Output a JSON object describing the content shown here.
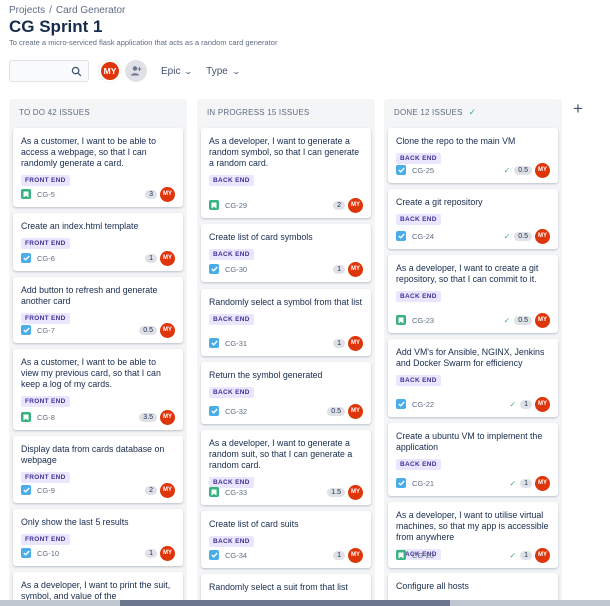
{
  "breadcrumb": {
    "projects": "Projects",
    "separator": "/",
    "project": "Card Generator"
  },
  "page": {
    "title": "CG Sprint 1",
    "subtitle": "To create a micro-serviced flask application that acts as a random card generator"
  },
  "toolbar": {
    "search_placeholder": "",
    "avatar_initials": "MY",
    "epic_label": "Epic",
    "type_label": "Type",
    "add_people_icon": "add-person-icon",
    "search_icon": "search-icon",
    "chevron_icon": "chevron-down-icon"
  },
  "colors": {
    "avatar": "#de350b",
    "label_bg": "#eae6ff",
    "label_fg": "#403294",
    "story": "#36b37e",
    "task": "#4bade8"
  },
  "columns": [
    {
      "header": "TO DO 42 ISSUES",
      "cards": [
        {
          "title": "As a customer, I want to be able to access a webpage, so that I can randomly generate a card.",
          "label": "FRONT END",
          "type": "story",
          "key": "CG-5",
          "estimate": "3",
          "assignee": "MY"
        },
        {
          "title": "Create an index.html template",
          "label": "FRONT END",
          "type": "task",
          "key": "CG-6",
          "estimate": "1",
          "assignee": "MY"
        },
        {
          "title": "Add button to refresh and generate another card",
          "label": "FRONT END",
          "type": "task",
          "key": "CG-7",
          "estimate": "0.5",
          "assignee": "MY"
        },
        {
          "title": "As a customer, I want to be able to view my previous card, so that I can keep a log of my cards.",
          "label": "FRONT END",
          "type": "story",
          "key": "CG-8",
          "estimate": "3.5",
          "assignee": "MY"
        },
        {
          "title": "Display data from cards database on webpage",
          "label": "FRONT END",
          "type": "task",
          "key": "CG-9",
          "estimate": "2",
          "assignee": "MY"
        },
        {
          "title": "Only show the last 5 results",
          "label": "FRONT END",
          "type": "task",
          "key": "CG-10",
          "estimate": "1",
          "assignee": "MY"
        },
        {
          "title": "As a developer, I want to print the suit, symbol, and value of the",
          "label": "",
          "type": "",
          "key": "",
          "estimate": "",
          "assignee": ""
        }
      ]
    },
    {
      "header": "IN PROGRESS 15 ISSUES",
      "cards": [
        {
          "title": "As a developer, I want to generate a random symbol, so that I can generate a random card.",
          "label": "BACK END",
          "type": "story",
          "key": "CG-29",
          "estimate": "2",
          "assignee": "MY"
        },
        {
          "title": "Create list of card symbols",
          "label": "BACK END",
          "type": "task",
          "key": "CG-30",
          "estimate": "1",
          "assignee": "MY"
        },
        {
          "title": "Randomly select a symbol from that list",
          "label": "BACK END",
          "type": "task",
          "key": "CG-31",
          "estimate": "1",
          "assignee": "MY"
        },
        {
          "title": "Return the symbol generated",
          "label": "BACK END",
          "type": "task",
          "key": "CG-32",
          "estimate": "0.5",
          "assignee": "MY"
        },
        {
          "title": "As a developer, I want to generate a random suit, so that I can generate a random card.",
          "label": "BACK END",
          "type": "story",
          "key": "CG-33",
          "estimate": "1.5",
          "assignee": "MY"
        },
        {
          "title": "Create list of card suits",
          "label": "BACK END",
          "type": "task",
          "key": "CG-34",
          "estimate": "1",
          "assignee": "MY"
        },
        {
          "title": "Randomly select a suit from that list",
          "label": "",
          "type": "",
          "key": "",
          "estimate": "",
          "assignee": ""
        }
      ]
    },
    {
      "header": "DONE 12 ISSUES",
      "header_check": "✓",
      "cards": [
        {
          "title": "Clone the repo to the main VM",
          "label": "BACK END",
          "type": "task",
          "key": "CG-25",
          "estimate": "0.5",
          "assignee": "MY",
          "done": "✓"
        },
        {
          "title": "Create a git repository",
          "label": "BACK END",
          "type": "task",
          "key": "CG-24",
          "estimate": "0.5",
          "assignee": "MY",
          "done": "✓"
        },
        {
          "title": "As a developer, I want to create a git repository, so that I can commit to it.",
          "label": "BACK END",
          "type": "story",
          "key": "CG-23",
          "estimate": "0.5",
          "assignee": "MY",
          "done": "✓"
        },
        {
          "title": "Add VM's for Ansible, NGINX, Jenkins and Docker Swarm for efficiency",
          "label": "BACK END",
          "type": "task",
          "key": "CG-22",
          "estimate": "1",
          "assignee": "MY",
          "done": "✓"
        },
        {
          "title": "Create a ubuntu VM to implement the application",
          "label": "BACK END",
          "type": "task",
          "key": "CG-21",
          "estimate": "1",
          "assignee": "MY",
          "done": "✓"
        },
        {
          "title": "As a developer, I want to utilise virtual machines, so that my app is accessible from anywhere",
          "label": "BACK END",
          "type": "story",
          "key": "CG-20",
          "estimate": "1",
          "assignee": "MY",
          "done": "✓"
        },
        {
          "title": "Configure all hosts",
          "label": "",
          "type": "",
          "key": "",
          "estimate": "",
          "assignee": ""
        }
      ]
    }
  ],
  "add_column": "+"
}
